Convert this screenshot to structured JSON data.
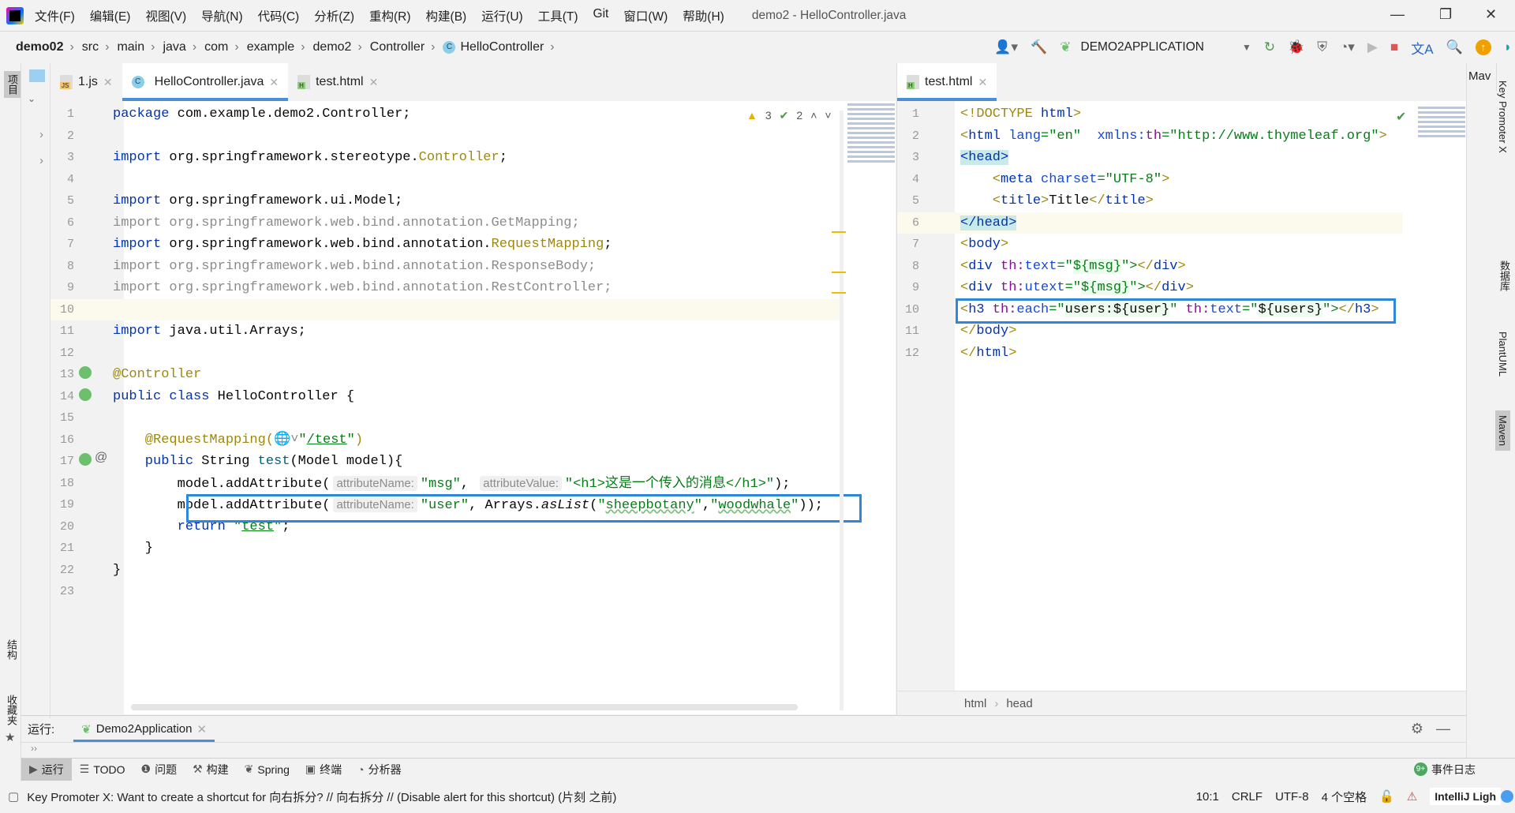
{
  "window": {
    "title": "demo2 - HelloController.java",
    "menus": [
      "文件(F)",
      "编辑(E)",
      "视图(V)",
      "导航(N)",
      "代码(C)",
      "分析(Z)",
      "重构(R)",
      "构建(B)",
      "运行(U)",
      "工具(T)",
      "Git",
      "窗口(W)",
      "帮助(H)"
    ]
  },
  "breadcrumb": [
    "demo02",
    "src",
    "main",
    "java",
    "com",
    "example",
    "demo2",
    "Controller",
    "HelloController"
  ],
  "toolbar": {
    "run_config": "DEMO2APPLICATION"
  },
  "left_sidebar": {
    "labels": [
      "项目",
      "结构",
      "收藏夹"
    ]
  },
  "right_sidebar": {
    "labels": [
      "Key Promoter X",
      "数据库",
      "PlantUML",
      "Maven"
    ],
    "tab": "Mav"
  },
  "left_editor": {
    "tabs": [
      {
        "label": "1.js",
        "icon": "js-file-icon"
      },
      {
        "label": "HelloController.java",
        "icon": "class-icon",
        "active": true
      },
      {
        "label": "test.html",
        "icon": "html-file-icon"
      }
    ],
    "inspections": {
      "warnings": "3",
      "ok": "2"
    },
    "lines": [
      [
        [
          "package",
          "kw"
        ],
        [
          " com.example.demo2.Controller;",
          ""
        ]
      ],
      [],
      [
        [
          "import",
          "kw"
        ],
        [
          " org.springframework.stereotype.",
          ""
        ],
        [
          "Controller",
          "ann"
        ],
        [
          ";",
          ""
        ]
      ],
      [],
      [
        [
          "import",
          "kw"
        ],
        [
          " org.springframework.ui.Model;",
          ""
        ]
      ],
      [
        [
          "import org.springframework.web.bind.annotation.GetMapping;",
          "gray"
        ]
      ],
      [
        [
          "import",
          "kw"
        ],
        [
          " org.springframework.web.bind.annotation.",
          ""
        ],
        [
          "RequestMapping",
          "ann"
        ],
        [
          ";",
          ""
        ]
      ],
      [
        [
          "import org.springframework.web.bind.annotation.ResponseBody;",
          "gray"
        ]
      ],
      [
        [
          "import org.springframework.web.bind.annotation.RestController;",
          "gray"
        ]
      ],
      [],
      [
        [
          "import",
          "kw"
        ],
        [
          " java.util.Arrays;",
          ""
        ]
      ],
      [],
      [
        [
          "@Controller",
          "ann"
        ]
      ],
      [
        [
          "public class",
          "kw"
        ],
        [
          " HelloController {",
          ""
        ]
      ],
      [],
      [
        [
          "    @RequestMapping(",
          "ann"
        ],
        [
          "🌐˅",
          "gray"
        ],
        [
          "\"",
          "str"
        ],
        [
          "/test",
          "str ul"
        ],
        [
          "\"",
          "str"
        ],
        [
          ")",
          "ann"
        ]
      ],
      [
        [
          "    public",
          "kw"
        ],
        [
          " String ",
          ""
        ],
        [
          "test",
          "meth"
        ],
        [
          "(Model model){",
          ""
        ]
      ],
      [
        [
          "        model.addAttribute(",
          ""
        ],
        [
          "attributeName:",
          "hint"
        ],
        [
          "\"msg\"",
          "str"
        ],
        [
          ", ",
          ""
        ],
        [
          "attributeValue:",
          "hint"
        ],
        [
          "\"<h1>这是一个传入的消息</h1>\"",
          "str"
        ],
        [
          ");",
          ""
        ]
      ],
      [
        [
          "        model.addAttribute(",
          ""
        ],
        [
          "attributeName:",
          "hint"
        ],
        [
          "\"user\"",
          "str"
        ],
        [
          ", Arrays.",
          ""
        ],
        [
          "asList",
          "it"
        ],
        [
          "(",
          ""
        ],
        [
          "\"",
          "str"
        ],
        [
          "sheepbotany",
          "str wavy"
        ],
        [
          "\"",
          "str"
        ],
        [
          ",",
          ""
        ],
        [
          "\"",
          "str"
        ],
        [
          "woodwhale",
          "str wavy"
        ],
        [
          "\"",
          "str"
        ],
        [
          "));",
          ""
        ]
      ],
      [
        [
          "        return",
          "kw"
        ],
        [
          " ",
          ""
        ],
        [
          "\"",
          "str"
        ],
        [
          "test",
          "str ul"
        ],
        [
          "\"",
          "str"
        ],
        [
          ";",
          ""
        ]
      ],
      [
        [
          "    }",
          ""
        ]
      ],
      [
        [
          "}",
          ""
        ]
      ],
      []
    ]
  },
  "right_editor": {
    "tabs": [
      {
        "label": "test.html",
        "icon": "html-file-icon",
        "active": true
      }
    ],
    "lines": [
      [
        [
          "<!DOCTYPE ",
          "tagb"
        ],
        [
          "html",
          "tag"
        ],
        [
          ">",
          "tagb"
        ]
      ],
      [
        [
          "<",
          "tagb"
        ],
        [
          "html",
          "tag"
        ],
        [
          " lang",
          "attr"
        ],
        [
          "=\"en\"",
          "val"
        ],
        [
          "  xmlns:",
          "attr"
        ],
        [
          "th",
          "th"
        ],
        [
          "=\"http://www.thymeleaf.org\"",
          "val"
        ],
        [
          ">",
          "tagb"
        ]
      ],
      [
        [
          "<head>",
          "tag hlhead"
        ]
      ],
      [
        [
          "    <",
          "tagb"
        ],
        [
          "meta",
          "tag"
        ],
        [
          " charset",
          "attr"
        ],
        [
          "=\"UTF-8\"",
          "val"
        ],
        [
          ">",
          "tagb"
        ]
      ],
      [
        [
          "    <",
          "tagb"
        ],
        [
          "title",
          "tag"
        ],
        [
          ">",
          "tagb"
        ],
        [
          "Title",
          ""
        ],
        [
          "</",
          "tagb"
        ],
        [
          "title",
          "tag"
        ],
        [
          ">",
          "tagb"
        ]
      ],
      [
        [
          "</head>",
          "tag hlhead"
        ]
      ],
      [
        [
          "<",
          "tagb"
        ],
        [
          "body",
          "tag"
        ],
        [
          ">",
          "tagb"
        ]
      ],
      [
        [
          "<",
          "tagb"
        ],
        [
          "div",
          "tag"
        ],
        [
          " th:",
          "th"
        ],
        [
          "text",
          "attr"
        ],
        [
          "=\"",
          "val"
        ],
        [
          "${msg}",
          "val valbg"
        ],
        [
          "\">",
          "val"
        ],
        [
          "</",
          "tagb"
        ],
        [
          "div",
          "tag"
        ],
        [
          ">",
          "tagb"
        ]
      ],
      [
        [
          "<",
          "tagb"
        ],
        [
          "div",
          "tag"
        ],
        [
          " th:",
          "th"
        ],
        [
          "utext",
          "attr"
        ],
        [
          "=\"",
          "val"
        ],
        [
          "${msg}",
          "val valbg"
        ],
        [
          "\">",
          "val"
        ],
        [
          "</",
          "tagb"
        ],
        [
          "div",
          "tag"
        ],
        [
          ">",
          "tagb"
        ]
      ],
      [
        [
          "<",
          "tagb"
        ],
        [
          "h3",
          "tag"
        ],
        [
          " th:",
          "th"
        ],
        [
          "each",
          "attr"
        ],
        [
          "=\"",
          "val"
        ],
        [
          "users:${user}",
          "valbg"
        ],
        [
          "\" ",
          "val"
        ],
        [
          "th:",
          "th"
        ],
        [
          "text",
          "attr"
        ],
        [
          "=\"",
          "val"
        ],
        [
          "${users}",
          "valbg"
        ],
        [
          "\">",
          "val"
        ],
        [
          "</",
          "tagb"
        ],
        [
          "h3",
          "tag"
        ],
        [
          ">",
          "tagb"
        ]
      ],
      [
        [
          "</",
          "tagb"
        ],
        [
          "body",
          "tag"
        ],
        [
          ">",
          "tagb"
        ]
      ],
      [
        [
          "</",
          "tagb"
        ],
        [
          "html",
          "tag"
        ],
        [
          ">",
          "tagb"
        ]
      ]
    ],
    "breadcrumb": [
      "html",
      "head"
    ]
  },
  "run_panel": {
    "label": "运行:",
    "tab": "Demo2Application"
  },
  "tool_buttons": [
    {
      "label": "运行",
      "icon": "run-icon",
      "active": true
    },
    {
      "label": "TODO",
      "icon": "list-icon"
    },
    {
      "label": "问题",
      "icon": "problems-icon"
    },
    {
      "label": "构建",
      "icon": "hammer-icon"
    },
    {
      "label": "Spring",
      "icon": "spring-icon"
    },
    {
      "label": "终端",
      "icon": "terminal-icon"
    },
    {
      "label": "分析器",
      "icon": "profiler-icon"
    }
  ],
  "event_log": {
    "badge": "9+",
    "label": "事件日志"
  },
  "status": {
    "message": "Key Promoter X: Want to create a shortcut for 向右拆分? // 向右拆分 // (Disable alert for this shortcut) (片刻 之前)",
    "position": "10:1",
    "line_sep": "CRLF",
    "encoding": "UTF-8",
    "indent": "4 个空格",
    "theme": "IntelliJ Ligh"
  },
  "colors": {
    "accent": "#4a90d9",
    "highlight_box": "#2f87dc",
    "keyword": "#0033b3",
    "string": "#067d17",
    "annotation": "#9e880d"
  }
}
